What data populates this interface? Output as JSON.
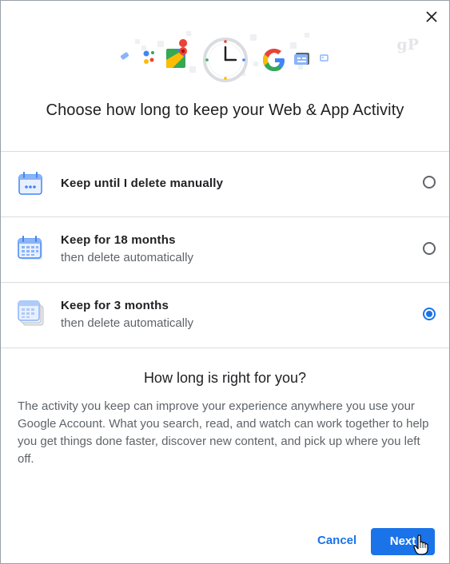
{
  "dialog": {
    "title": "Choose how long to keep your Web & App Activity",
    "watermark": "gP",
    "options": [
      {
        "main": "Keep until I delete manually",
        "sub": "",
        "selected": false
      },
      {
        "main": "Keep for 18 months",
        "sub": "then delete automatically",
        "selected": false
      },
      {
        "main": "Keep for 3 months",
        "sub": "then delete automatically",
        "selected": true
      }
    ],
    "info_heading": "How long is right for you?",
    "info_body": "The activity you keep can improve your experience anywhere you use your Google Account. What you search, read, and watch can work together to help you get things done faster, discover new content, and pick up where you left off.",
    "cancel_label": "Cancel",
    "next_label": "Next",
    "accent_color": "#1a73e8"
  }
}
